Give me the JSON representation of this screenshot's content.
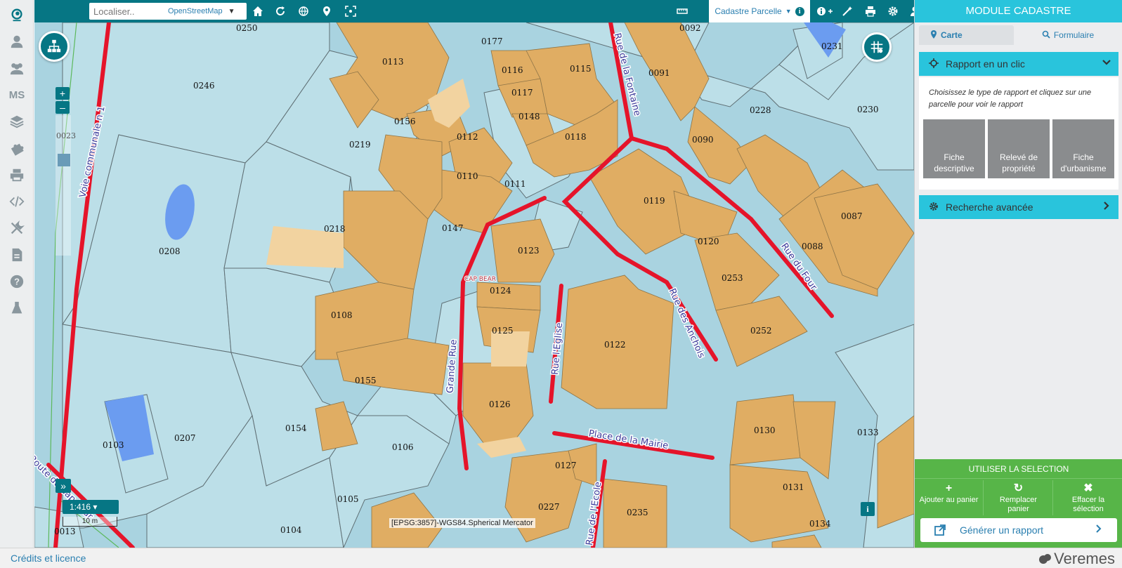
{
  "topbar": {
    "search_placeholder": "Localiser..",
    "search_provider": "OpenStreetMap",
    "module_tab_label": "Cadastre Parcelle",
    "info_glyph": "i",
    "icons": [
      "home-icon",
      "refresh-icon",
      "globe-icon",
      "map-marker-icon",
      "fullscreen-icon",
      "ruler-icon",
      "info-plus-icon",
      "magic-wand-icon",
      "print-icon",
      "gear-icon",
      "user-icon"
    ]
  },
  "leftbar": {
    "items": [
      "logo-icon",
      "user-icon",
      "users-icon",
      "MS",
      "layers-icon",
      "puzzle-icon",
      "print-icon",
      "code-icon",
      "tools-icon",
      "document-icon",
      "help-icon",
      "flask-icon"
    ],
    "ms_label": "MS"
  },
  "map": {
    "zoom_in": "+",
    "zoom_out": "–",
    "zoom_level": "0023",
    "expand_label": "»",
    "scale_label": "1:416",
    "scalebar_label": "10 m",
    "projection_label": "[EPSG:3857]-WGS84.Spherical Mercator",
    "place_label": "CAP BEAR",
    "info_button": "i",
    "parcels": [
      "0250",
      "0177",
      "0092",
      "0231",
      "0113",
      "0116",
      "0115",
      "0091",
      "0246",
      "0117",
      "0228",
      "0230",
      "0148",
      "0156",
      "0112",
      "0118",
      "0090",
      "0219",
      "0111",
      "0110",
      "0119",
      "0087",
      "0218",
      "0147",
      "0120",
      "0088",
      "0208",
      "0123",
      "0253",
      "0124",
      "0108",
      "0125",
      "0122",
      "0252",
      "0155",
      "0126",
      "0130",
      "0133",
      "0154",
      "0106",
      "0207",
      "0103",
      "0127",
      "0131",
      "0105",
      "0227",
      "0235",
      "0104",
      "0134",
      "0013"
    ],
    "streets": [
      "Voie communale n 1",
      "Rue de la Fontaine",
      "Grande Rue",
      "Rue l'Eglise",
      "Rue des Anchois",
      "Rue du Four",
      "Place de la Mairie",
      "Rue de l'Ecole",
      "Route du Cap Bear"
    ]
  },
  "panel": {
    "title": "MODULE CADASTRE",
    "tab_carte": "Carte",
    "tab_formulaire": "Formulaire",
    "section_rapport": "Rapport en un clic",
    "instructions": "Choisissez le type de rapport et cliquez sur une parcelle pour voir le rapport",
    "report_buttons": [
      {
        "line1": "Fiche",
        "line2": "descriptive"
      },
      {
        "line1": "Relevé de",
        "line2": "propriété"
      },
      {
        "line1": "Fiche",
        "line2": "d'urbanisme"
      }
    ],
    "section_recherche": "Recherche avancée",
    "selection_title": "UTILISER LA SELECTION",
    "sel_buttons": [
      {
        "icon": "+",
        "line1": "Ajouter au panier",
        "line2": ""
      },
      {
        "icon": "↻",
        "line1": "Remplacer",
        "line2": "panier"
      },
      {
        "icon": "✖",
        "line1": "Effacer la",
        "line2": "sélection"
      }
    ],
    "generate_label": "Générer un rapport"
  },
  "footer": {
    "credits": "Crédits et licence",
    "brand": "Veremes"
  },
  "colors": {
    "teal": "#067684",
    "cyan": "#29c4dc",
    "green": "#57b548",
    "parcel_building": "#e0ad63",
    "parcel_light": "#bcdfe8",
    "road": "#a9d3e0",
    "street_red": "#e5142a"
  }
}
